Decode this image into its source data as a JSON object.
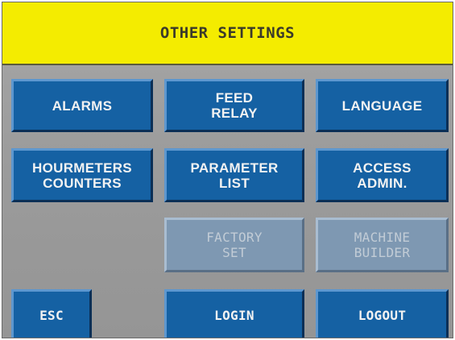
{
  "screen": {
    "title": "OTHER SETTINGS"
  },
  "buttons": {
    "alarms": "ALARMS",
    "feed_relay": "FEED\nRELAY",
    "language": "LANGUAGE",
    "hourmeters_counters": "HOURMETERS\nCOUNTERS",
    "parameter_list": "PARAMETER\nLIST",
    "access_admin": "ACCESS\nADMIN.",
    "factory_set": "FACTORY\nSET",
    "machine_builder": "MACHINE\nBUILDER",
    "esc": "ESC",
    "login": "LOGIN",
    "logout": "LOGOUT"
  },
  "colors": {
    "title_background": "#f4ec00",
    "button_blue": "#1561a3",
    "button_disabled": "#7e98b2",
    "panel_gray": "#9e9e9e"
  }
}
